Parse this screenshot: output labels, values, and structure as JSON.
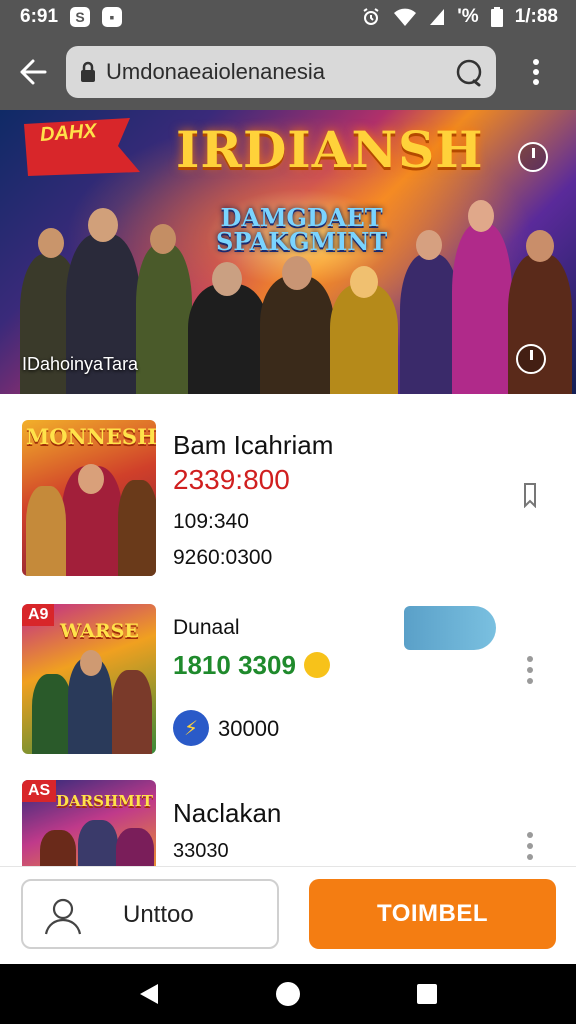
{
  "status_bar": {
    "time_left": "6:91",
    "app_icon_1": "S",
    "app_icon_2": "▪",
    "signal_text": "'%",
    "time_right": "1/:88",
    "icons": [
      "alarm-icon",
      "wifi-icon",
      "signal-icon",
      "battery-icon"
    ]
  },
  "browser": {
    "url": "Umdonaeaiolenanesia",
    "icons": [
      "back-arrow-icon",
      "lock-icon",
      "reload-icon",
      "more-vert-icon"
    ]
  },
  "banner": {
    "flag_text": "DAHX",
    "title": "IRDIANSH",
    "subtitle_line1": "DAMGDAET",
    "subtitle_line2": "SPAKGMINT",
    "caption": "IDahoinyaTara",
    "colors": {
      "title": "#ffd23a",
      "subtitle": "#7ad4ff"
    }
  },
  "items": [
    {
      "thumb_label": "MONNESH",
      "title": "Bam Icahriam",
      "price": "2339:800",
      "line2": "109:340",
      "line3": "9260:0300",
      "price_color": "#d01f1f"
    },
    {
      "thumb_badge": "A9",
      "thumb_label": "WARSE",
      "title": "Dunaal",
      "price": "1810 3309",
      "line2": "30000",
      "price_color": "#1f8a2c"
    },
    {
      "thumb_badge": "AS",
      "thumb_label": "DARSHMIT",
      "title": "Naclakan",
      "line2": "33030"
    }
  ],
  "bottom": {
    "user_label": "Unttoo",
    "cta_label": "TOIMBEL",
    "cta_color": "#f47d12"
  },
  "nav": {
    "icons": [
      "back-triangle-icon",
      "home-circle-icon",
      "recents-square-icon"
    ]
  }
}
